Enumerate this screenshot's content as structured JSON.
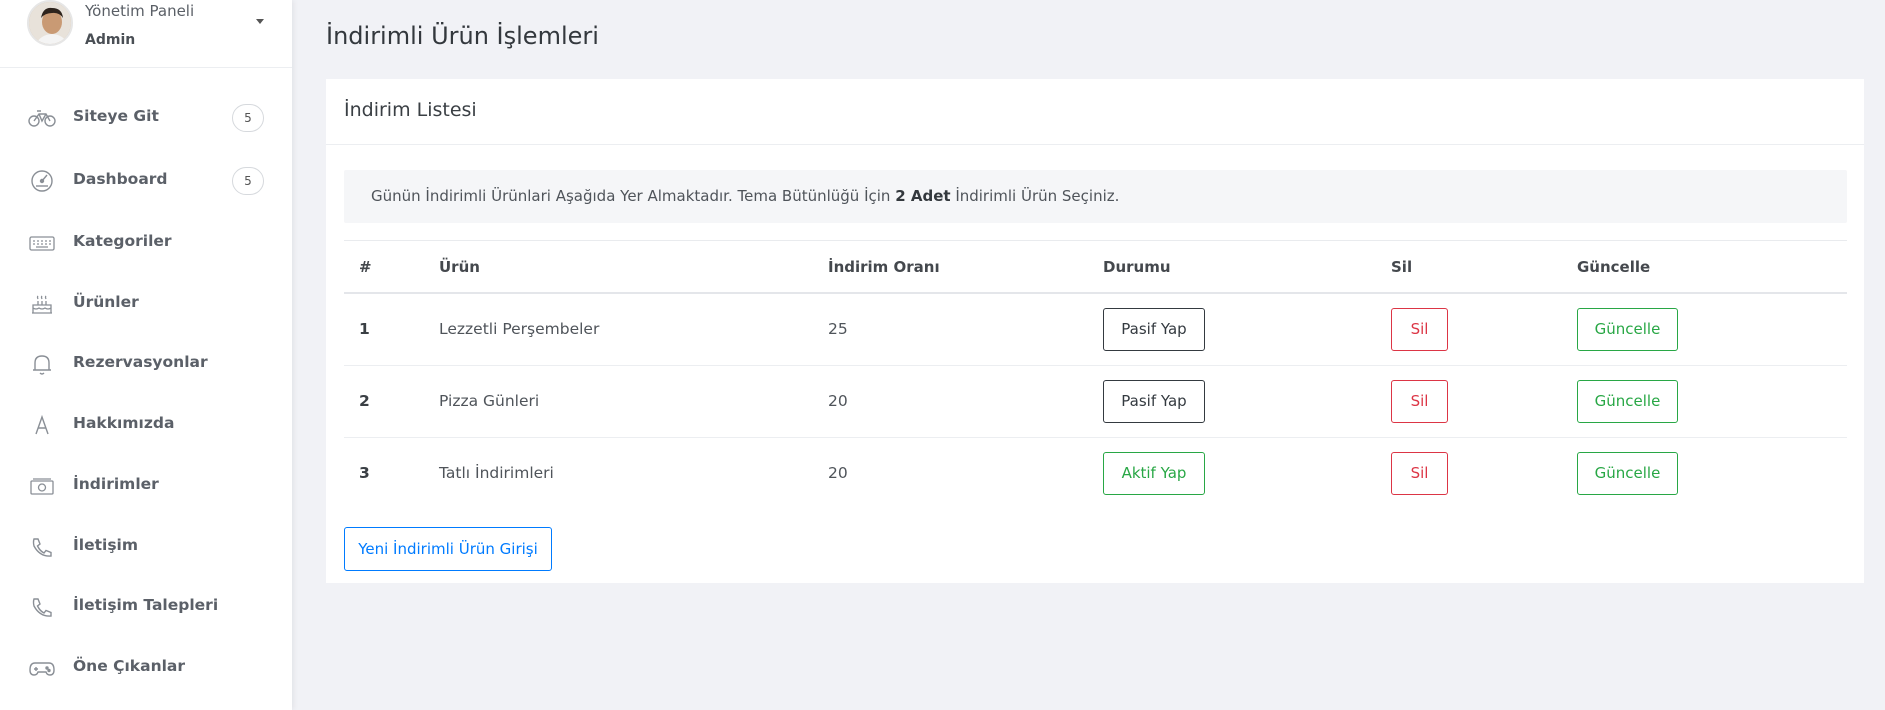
{
  "sidebar": {
    "profile": {
      "name": "Yönetim Paneli",
      "role": "Admin"
    },
    "items": [
      {
        "label": "Siteye Git",
        "icon": "bicycle-icon",
        "badge": "5"
      },
      {
        "label": "Dashboard",
        "icon": "gauge-icon",
        "badge": "5"
      },
      {
        "label": "Kategoriler",
        "icon": "keyboard-icon"
      },
      {
        "label": "Ürünler",
        "icon": "cake-icon"
      },
      {
        "label": "Rezervasyonlar",
        "icon": "bell-icon"
      },
      {
        "label": "Hakkımızda",
        "icon": "letter-a-icon"
      },
      {
        "label": "İndirimler",
        "icon": "money-icon"
      },
      {
        "label": "İletişim",
        "icon": "phone-icon"
      },
      {
        "label": "İletişim Talepleri",
        "icon": "phone-icon"
      },
      {
        "label": "Öne Çıkanlar",
        "icon": "gamepad-icon"
      }
    ]
  },
  "page": {
    "title": "İndirimli Ürün İşlemleri"
  },
  "card": {
    "title": "İndirim Listesi",
    "alert": {
      "before": "Günün İndirimli Ürünlari Aşağıda Yer Almaktadır. Tema Bütünlüğü İçin ",
      "bold": "2 Adet",
      "after": " İndirimli Ürün Seçiniz."
    },
    "table": {
      "headers": {
        "index": "#",
        "product": "Ürün",
        "rate": "İndirim Oranı",
        "status": "Durumu",
        "delete": "Sil",
        "update": "Güncelle"
      },
      "rows": [
        {
          "index": "1",
          "product": "Lezzetli Perşembeler",
          "rate": "25",
          "status_button": "Pasif Yap",
          "delete_button": "Sil",
          "update_button": "Güncelle"
        },
        {
          "index": "2",
          "product": "Pizza Günleri",
          "rate": "20",
          "status_button": "Pasif Yap",
          "delete_button": "Sil",
          "update_button": "Güncelle"
        },
        {
          "index": "3",
          "product": "Tatlı İndirimleri",
          "rate": "20",
          "status_button": "Aktif Yap",
          "delete_button": "Sil",
          "update_button": "Güncelle"
        }
      ]
    },
    "new_button": "Yeni İndirimli Ürün Girişi"
  },
  "colors": {
    "dark": "#343a40",
    "success": "#28a745",
    "danger": "#dc3545",
    "primary": "#007bff",
    "background": "#f1f2f6"
  }
}
